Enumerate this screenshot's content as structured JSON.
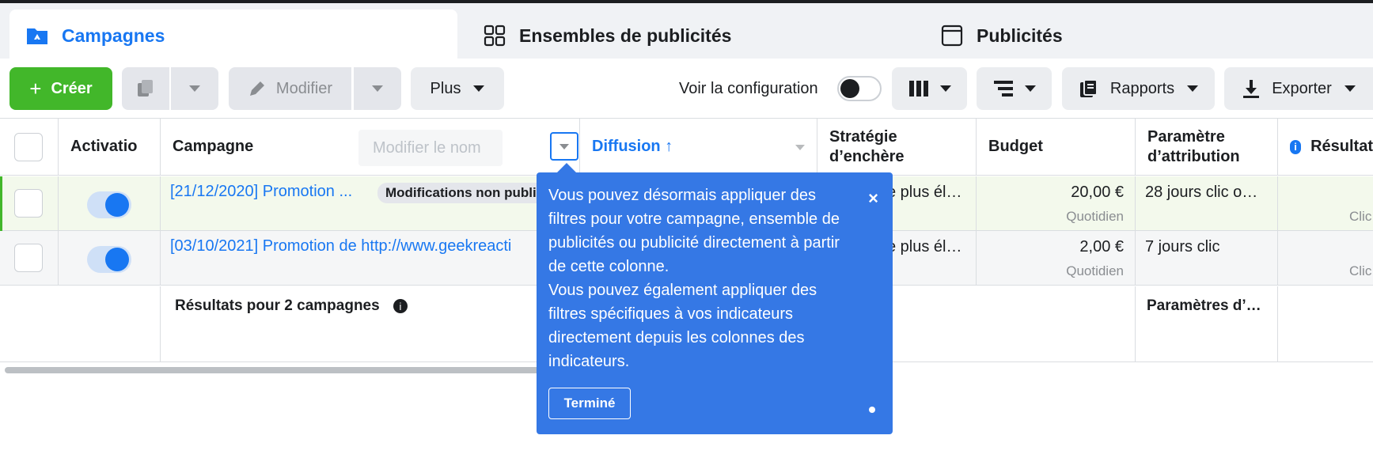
{
  "tabs": [
    {
      "label": "Campagnes",
      "icon": "folder-icon",
      "active": true
    },
    {
      "label": "Ensembles de publicités",
      "icon": "grid-icon"
    },
    {
      "label": "Publicités",
      "icon": "window-icon"
    }
  ],
  "toolbar": {
    "create_label": "Créer",
    "edit_label": "Modifier",
    "more_label": "Plus",
    "config_label": "Voir la configuration",
    "reports_label": "Rapports",
    "export_label": "Exporter",
    "icons": [
      "duplicate-icon",
      "pencil-icon",
      "columns-icon",
      "breakdown-icon",
      "reports-icon",
      "download-icon"
    ]
  },
  "table": {
    "headers": {
      "activation": "Activatio",
      "campaign": "Campagne",
      "rename_placeholder": "Modifier le nom",
      "delivery": "Diffusion ↑",
      "bid_strategy_1": "Stratégie",
      "bid_strategy_2": "d’enchère",
      "budget": "Budget",
      "attribution_1": "Paramètre",
      "attribution_2": "d’attribution",
      "results": "Résultat"
    },
    "rows": [
      {
        "name": "[21/12/2020] Promotion ...",
        "badge": "Modifications non publiées",
        "bid_strategy": "e plus él…",
        "budget": "20,00 €",
        "budget_period": "Quotidien",
        "attribution": "28 jours clic o…",
        "results": "Clic"
      },
      {
        "name": "[03/10/2021] Promotion de http://www.geekreacti",
        "bid_strategy": "e plus él…",
        "budget": "2,00 €",
        "budget_period": "Quotidien",
        "attribution": "7 jours clic",
        "results": "Clic"
      }
    ],
    "summary": {
      "label": "Résultats pour 2 campagnes",
      "attribution": "Paramètres d’…"
    }
  },
  "tooltip": {
    "text_1": "Vous pouvez désormais appliquer des filtres pour votre campagne, ensemble de publicités ou publicité directement à partir de cette colonne.",
    "text_2": "Vous pouvez également appliquer des filtres spécifiques à vos indicateurs directement depuis les colonnes des indicateurs.",
    "done_label": "Terminé",
    "close_glyph": "×"
  },
  "colors": {
    "accent": "#1877f2",
    "create": "#42b72a",
    "tooltip": "#3578e5"
  }
}
